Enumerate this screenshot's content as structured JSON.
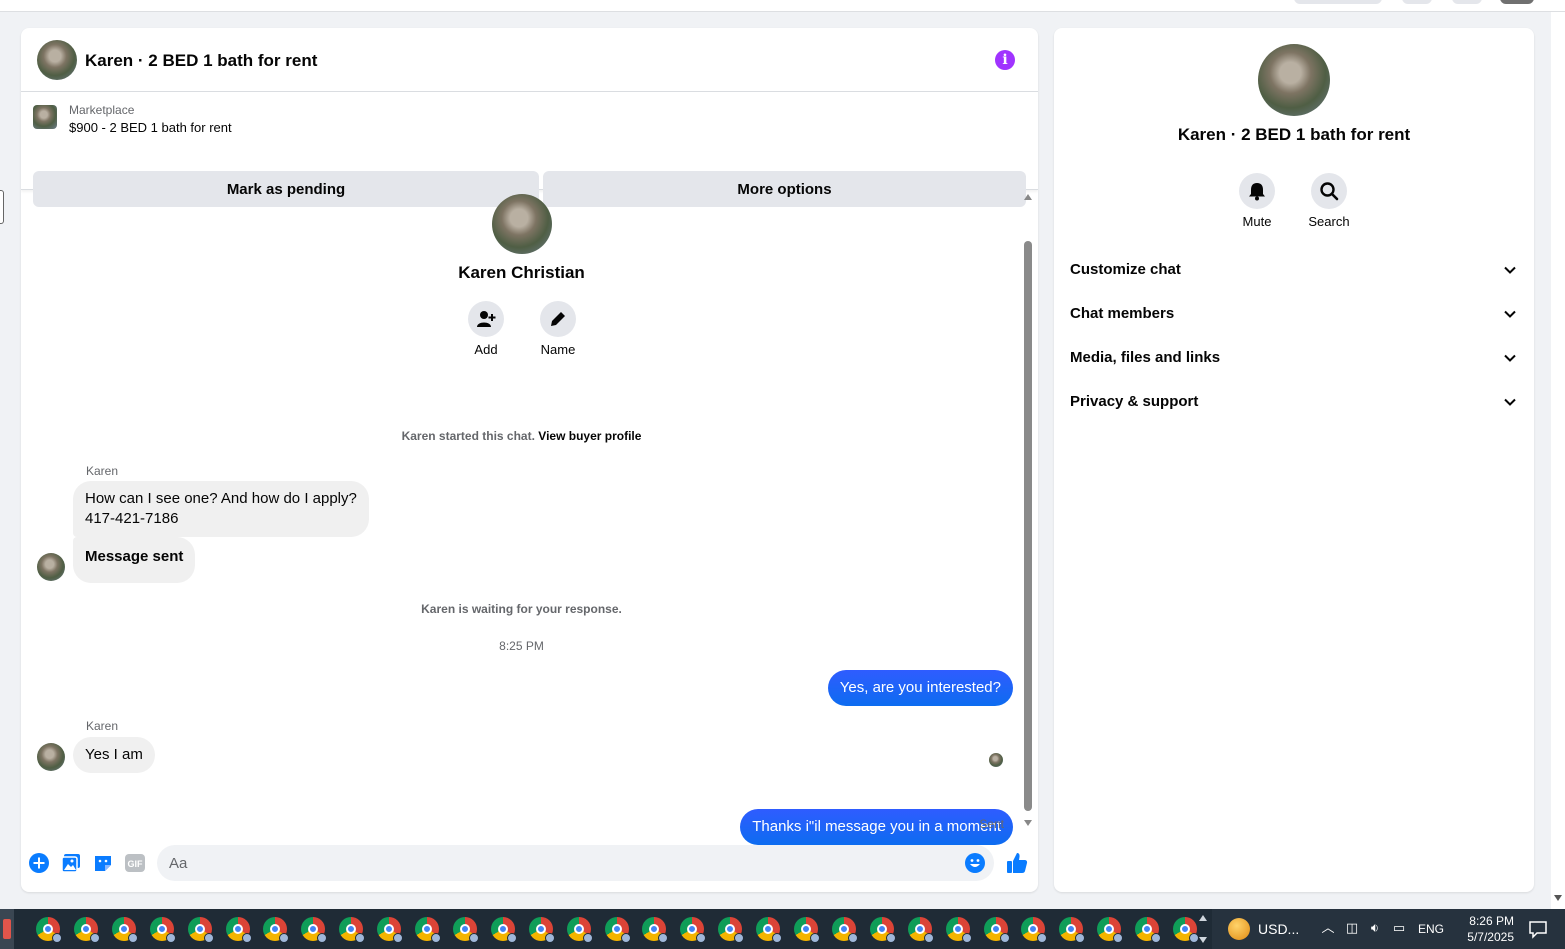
{
  "header": {
    "title": "Karen · 2 BED 1 bath for rent"
  },
  "marketplace": {
    "label": "Marketplace",
    "listing": "$900 - 2 BED 1 bath for rent",
    "mark_pending": "Mark as pending",
    "more_options": "More options"
  },
  "contact": {
    "name": "Karen Christian",
    "add_label": "Add",
    "name_label": "Name"
  },
  "messages": {
    "started_text": "Karen started this chat.",
    "view_profile": "View buyer profile",
    "sender": "Karen",
    "msg1_line1": "How can I see one?  And how do I apply?",
    "msg1_line2": "417-421-7186",
    "msg2": "Message sent",
    "waiting": "Karen is waiting for your response.",
    "timestamp": "8:25 PM",
    "out1": "Yes, are you interested?",
    "sender2": "Karen",
    "msg3": "Yes I am",
    "out2": "Thanks i\"il message you in a moment",
    "sent_status": "Sent"
  },
  "composer": {
    "placeholder": "Aa"
  },
  "info_panel": {
    "title": "Karen · 2 BED 1 bath for rent",
    "mute": "Mute",
    "search": "Search",
    "sections": [
      "Customize chat",
      "Chat members",
      "Media, files and links",
      "Privacy & support"
    ]
  },
  "taskbar": {
    "currency": "USD...",
    "lang": "ENG",
    "time": "8:26 PM",
    "date": "5/7/2025"
  },
  "colors": {
    "accent": "#0a7cff",
    "info": "#a033ff",
    "bubble_in": "#f0f0f0",
    "button_bg": "#e4e6eb"
  }
}
